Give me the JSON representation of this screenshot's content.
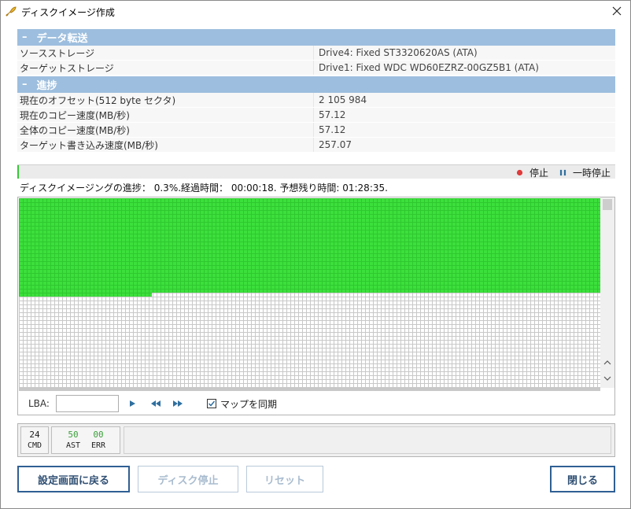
{
  "window": {
    "title": "ディスクイメージ作成"
  },
  "sections": {
    "transfer": {
      "header": "データ転送",
      "rows": [
        {
          "label": "ソースストレージ",
          "value": "Drive4: Fixed ST3320620AS (ATA)"
        },
        {
          "label": "ターゲットストレージ",
          "value": "Drive1: Fixed WDC WD60EZRZ-00GZ5B1 (ATA)"
        }
      ]
    },
    "progress": {
      "header": "進捗",
      "rows": [
        {
          "label": "現在のオフセット(512 byte セクタ)",
          "value": "2 105 984"
        },
        {
          "label": "現在のコピー速度(MB/秒)",
          "value": "57.12"
        },
        {
          "label": "全体のコピー速度(MB/秒)",
          "value": "57.12"
        },
        {
          "label": "ターゲット書き込み速度(MB/秒)",
          "value": "257.07"
        }
      ]
    }
  },
  "progress_bar": {
    "fraction": 0.003,
    "stop_label": "停止",
    "pause_label": "一時停止",
    "fill_color": "#36c836"
  },
  "status": {
    "text": "ディスクイメージングの進捗： 0.3%.経過時間： 00:00:18. 予想残り時間: 01:28:35."
  },
  "map": {
    "filled_color": "#3ce03c",
    "lba_label": "LBA:",
    "lba_value": "",
    "sync_label": "マップを同期",
    "sync_checked": true
  },
  "stats": {
    "cmd": {
      "value": "24",
      "label": "CMD"
    },
    "ast": {
      "value": "50",
      "label": "AST"
    },
    "err": {
      "value": "00",
      "label": "ERR"
    },
    "ok_color": "#3aa03a"
  },
  "buttons": {
    "back": "設定画面に戻る",
    "stop_disk": "ディスク停止",
    "reset": "リセット",
    "close": "閉じる"
  },
  "colors": {
    "section_header": "#9dbede",
    "accent": "#2f5f93"
  }
}
